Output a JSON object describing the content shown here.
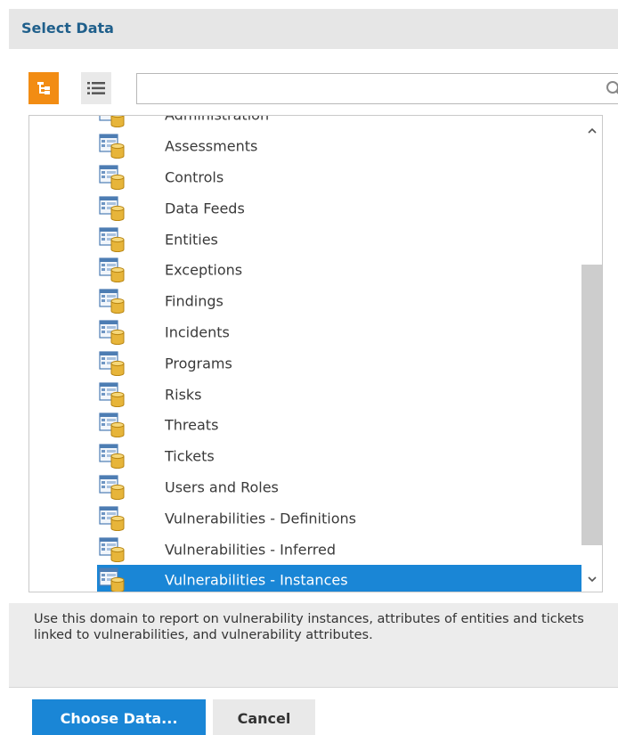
{
  "header": {
    "title": "Select Data"
  },
  "toolbar": {
    "tree_view_icon": "tree-view-icon",
    "list_view_icon": "list-view-icon",
    "search": {
      "value": "",
      "placeholder": "",
      "icon": "search-icon"
    }
  },
  "list": {
    "items": [
      {
        "label": "Administration",
        "icon": "data-table-icon"
      },
      {
        "label": "Assessments",
        "icon": "data-table-icon"
      },
      {
        "label": "Controls",
        "icon": "data-table-icon"
      },
      {
        "label": "Data Feeds",
        "icon": "data-table-icon"
      },
      {
        "label": "Entities",
        "icon": "data-table-icon"
      },
      {
        "label": "Exceptions",
        "icon": "data-table-icon"
      },
      {
        "label": "Findings",
        "icon": "data-table-icon"
      },
      {
        "label": "Incidents",
        "icon": "data-table-icon"
      },
      {
        "label": "Programs",
        "icon": "data-table-icon"
      },
      {
        "label": "Risks",
        "icon": "data-table-icon"
      },
      {
        "label": "Threats",
        "icon": "data-table-icon"
      },
      {
        "label": "Tickets",
        "icon": "data-table-icon"
      },
      {
        "label": "Users and Roles",
        "icon": "data-table-icon"
      },
      {
        "label": "Vulnerabilities - Definitions",
        "icon": "data-table-icon"
      },
      {
        "label": "Vulnerabilities - Inferred",
        "icon": "data-table-icon"
      },
      {
        "label": "Vulnerabilities - Instances",
        "icon": "data-table-icon",
        "selected": true
      }
    ]
  },
  "description": {
    "text": "Use this domain to report on vulnerability instances, attributes of entities and tickets linked to vulnerabilities, and vulnerability attributes."
  },
  "footer": {
    "choose_label": "Choose Data...",
    "cancel_label": "Cancel"
  },
  "colors": {
    "accent_blue": "#1a86d6",
    "tree_button_orange": "#f28c13",
    "title_blue": "#1f5f8b"
  }
}
